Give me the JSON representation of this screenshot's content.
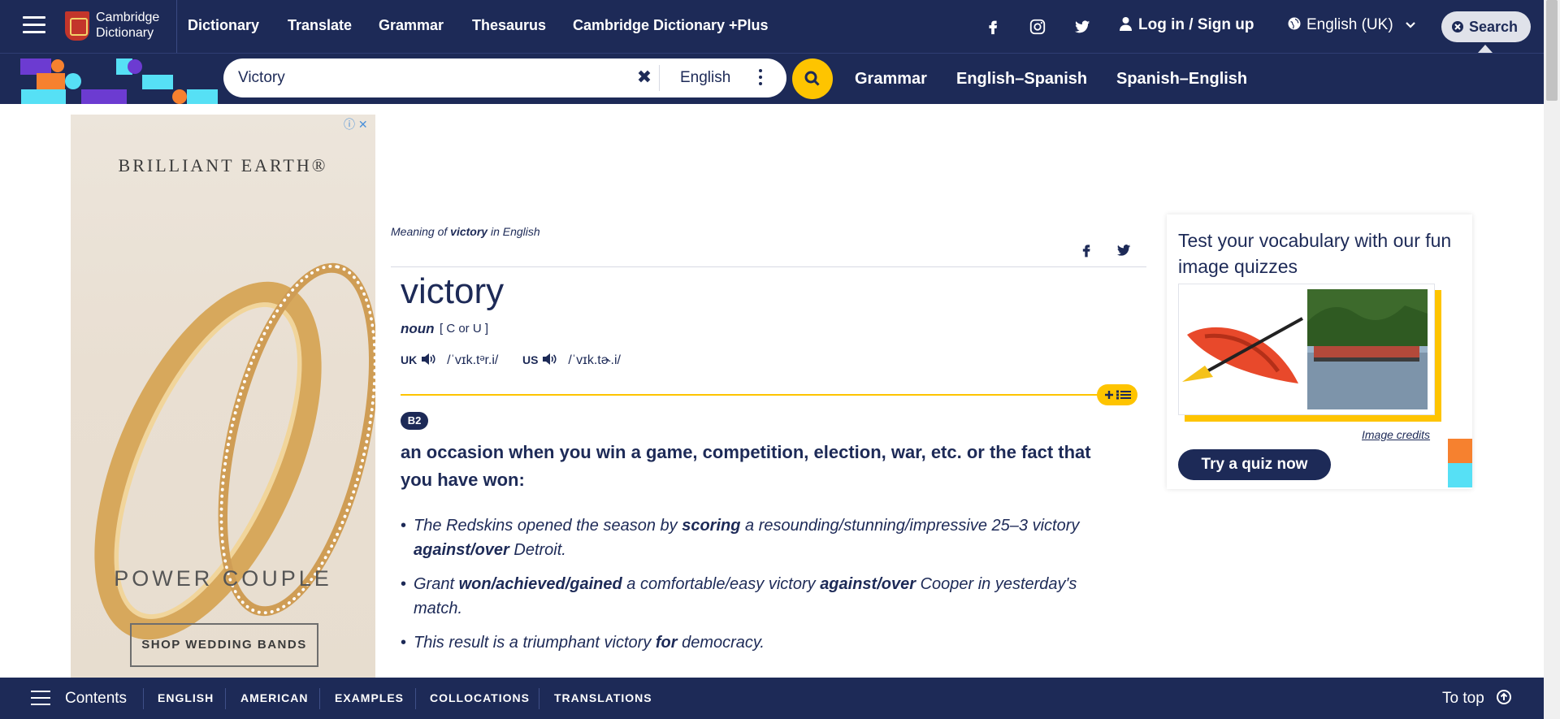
{
  "header": {
    "logo_line1": "Cambridge",
    "logo_line2": "Dictionary",
    "nav": [
      "Dictionary",
      "Translate",
      "Grammar",
      "Thesaurus",
      "Cambridge Dictionary +Plus"
    ],
    "login": "Log in / Sign up",
    "language": "English (UK)",
    "search_button": "Search"
  },
  "search": {
    "value": "Victory",
    "dictionary": "English",
    "links": [
      "Grammar",
      "English–Spanish",
      "Spanish–English"
    ]
  },
  "ad": {
    "brand": "BRILLIANT EARTH®",
    "tagline": "POWER COUPLE",
    "cta": "SHOP WEDDING BANDS"
  },
  "entry": {
    "meaning_prefix": "Meaning of",
    "meaning_word": "victory",
    "meaning_suffix": "in English",
    "headword": "victory",
    "pos": "noun",
    "grammar": "[ C or U ]",
    "uk_label": "UK",
    "uk_ipa": "/ˈvɪk.tᵊr.i/",
    "us_label": "US",
    "us_ipa": "/ˈvɪk.tɚ.i/",
    "level": "B2",
    "definition": "an occasion when you win a game, competition, election, war, etc. or the fact that you have won:",
    "examples": [
      [
        "The Redskins opened the season by ",
        "scoring",
        " a resounding/stunning/impressive 25–3 victory ",
        "against/over",
        " Detroit."
      ],
      [
        "Grant ",
        "won/achieved/gained",
        " a comfortable/easy victory ",
        "against/over",
        " Cooper in yesterday's match."
      ],
      [
        "This result is a triumphant victory ",
        "for",
        " democracy."
      ]
    ]
  },
  "quiz": {
    "title": "Test your vocabulary with our fun image quizzes",
    "credits": "Image credits",
    "button": "Try a quiz now"
  },
  "bottom": {
    "contents": "Contents",
    "tabs": [
      "ENGLISH",
      "AMERICAN",
      "EXAMPLES",
      "COLLOCATIONS",
      "TRANSLATIONS"
    ],
    "to_top": "To top"
  },
  "colors": {
    "navy": "#1d2a57",
    "yellow": "#fec400",
    "orange": "#f6812f",
    "cyan": "#56e0f5",
    "purple": "#6c3bd1"
  }
}
